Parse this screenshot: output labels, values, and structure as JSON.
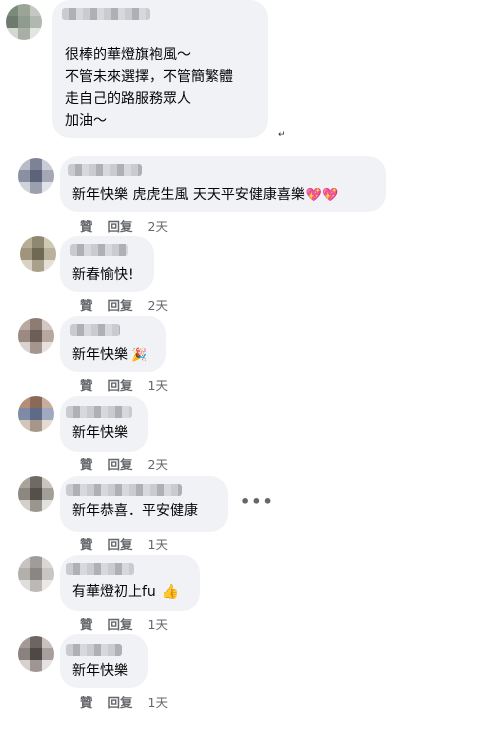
{
  "actions": {
    "like": "贊",
    "reply": "回复"
  },
  "comments": [
    {
      "lines": [
        "很棒的華燈旗袍風～",
        "不管未來選擇，不管簡繁體",
        "走自己的路服務眾人",
        "加油～"
      ]
    },
    {
      "text": "新年快樂 虎虎生風 天天平安健康喜樂",
      "emoji": "heart-ribbon",
      "time": "2天"
    },
    {
      "text": "新春愉快!",
      "time": "2天"
    },
    {
      "text": "新年快樂",
      "emoji": "party-popper",
      "time": "1天"
    },
    {
      "text": "新年快樂",
      "time": "2天"
    },
    {
      "text": "新年恭喜．平安健康",
      "time": "1天"
    },
    {
      "text": "有華燈初上fu",
      "emoji": "thumbs-up",
      "time": "1天"
    },
    {
      "text": "新年快樂",
      "time": "1天"
    }
  ],
  "more_icon": "more-horizontal-icon"
}
